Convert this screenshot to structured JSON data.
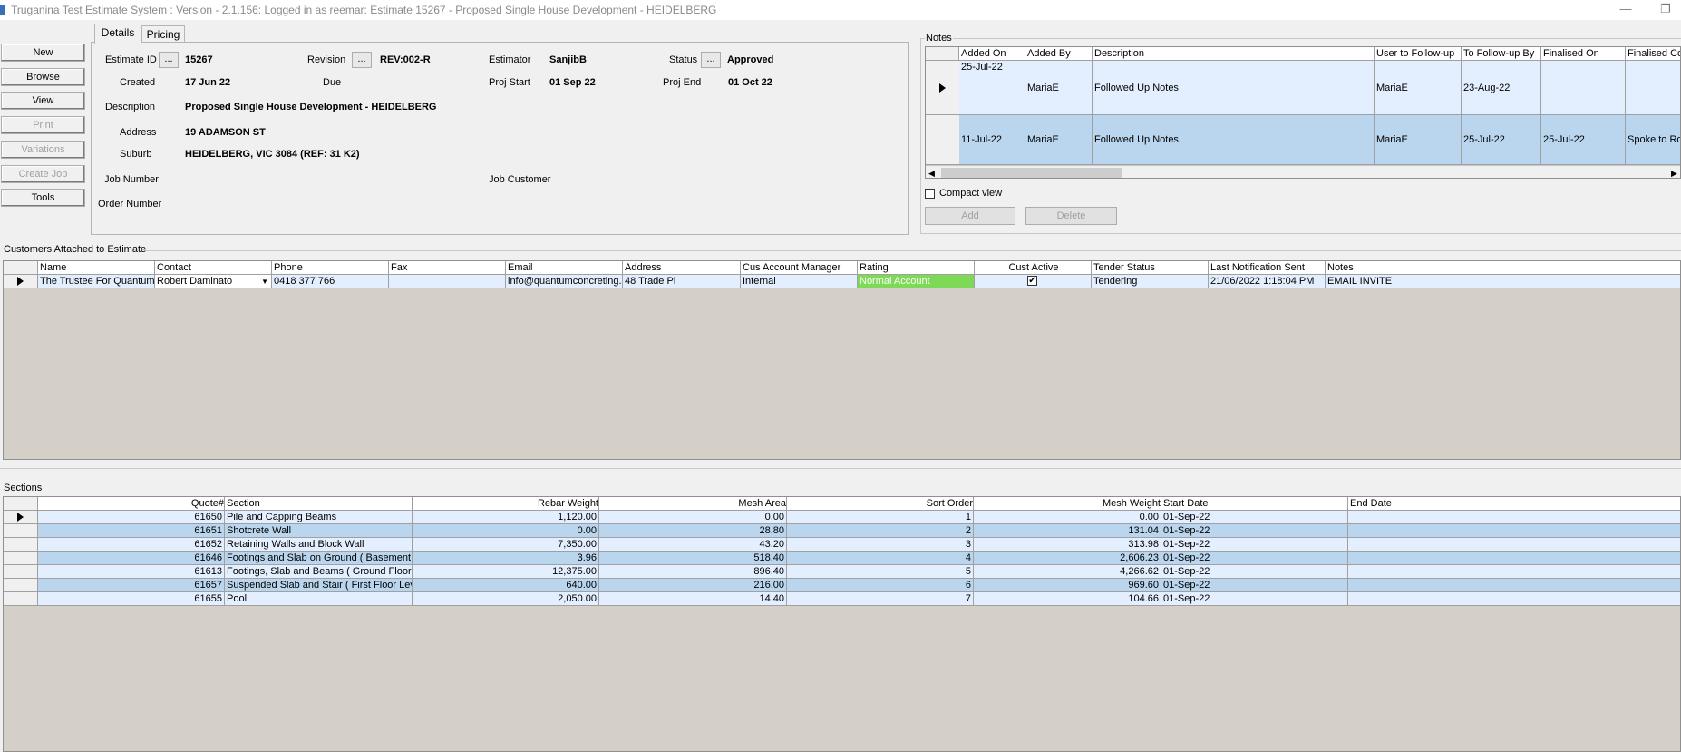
{
  "window": {
    "title": "Truganina Test Estimate System : Version - 2.1.156: Logged in as reemar: Estimate 15267 - Proposed Single House Development - HEIDELBERG"
  },
  "nav": {
    "new": "New",
    "browse": "Browse",
    "view": "View",
    "print": "Print",
    "variations": "Variations",
    "create_job": "Create Job",
    "tools": "Tools"
  },
  "tabs": {
    "details": "Details",
    "pricing": "Pricing"
  },
  "details": {
    "estimate_id_label": "Estimate ID",
    "estimate_id": "15267",
    "revision_label": "Revision",
    "revision": "REV:002-R",
    "estimator_label": "Estimator",
    "estimator": "SanjibB",
    "status_label": "Status",
    "status": "Approved",
    "created_label": "Created",
    "created": "17 Jun 22",
    "due_label": "Due",
    "proj_start_label": "Proj Start",
    "proj_start": "01 Sep 22",
    "proj_end_label": "Proj End",
    "proj_end": "01 Oct 22",
    "description_label": "Description",
    "description": "Proposed Single House Development - HEIDELBERG",
    "address_label": "Address",
    "address": "19 ADAMSON ST",
    "suburb_label": "Suburb",
    "suburb": "HEIDELBERG, VIC 3084 (REF: 31 K2)",
    "job_number_label": "Job Number",
    "job_customer_label": "Job Customer",
    "order_number_label": "Order Number",
    "dots": "..."
  },
  "notes": {
    "legend": "Notes",
    "columns": [
      "Added On",
      "Added By",
      "Description",
      "User to Follow-up",
      "To Follow-up By",
      "Finalised On",
      "Finalised Co"
    ],
    "rows": [
      [
        "25-Jul-22",
        "MariaE",
        "Followed Up Notes",
        "MariaE",
        "23-Aug-22",
        "",
        ""
      ],
      [
        "11-Jul-22",
        "MariaE",
        "Followed Up Notes",
        "MariaE",
        "25-Jul-22",
        "25-Jul-22",
        "Spoke to Ro"
      ]
    ],
    "compact_view": "Compact view",
    "add": "Add",
    "delete": "Delete"
  },
  "customers": {
    "legend": "Customers Attached to Estimate",
    "columns": [
      "Name",
      "Contact",
      "Phone",
      "Fax",
      "Email",
      "Address",
      "Cus Account Manager",
      "Rating",
      "Cust Active",
      "Tender Status",
      "Last Notification Sent",
      "Notes"
    ],
    "row": {
      "name": "The Trustee For Quantum",
      "contact": "Robert Daminato",
      "phone": "0418 377 766",
      "fax": "",
      "email": "info@quantumconcreting.c",
      "address": "48 Trade Pl",
      "manager": "Internal",
      "rating": "Normal Account",
      "cust_active": true,
      "tender_status": "Tendering",
      "last_notification": "21/06/2022 1:18:04 PM",
      "notes": "EMAIL INVITE"
    },
    "rating_color": "#7ed957"
  },
  "sections": {
    "legend": "Sections",
    "columns": [
      "Quote#",
      "Section",
      "Rebar Weight",
      "Mesh Area",
      "Sort Order",
      "Mesh Weight",
      "Start Date",
      "End Date"
    ],
    "rows": [
      [
        "61650",
        "Pile and Capping Beams",
        "1,120.00",
        "0.00",
        "1",
        "0.00",
        "01-Sep-22",
        ""
      ],
      [
        "61651",
        "Shotcrete Wall",
        "0.00",
        "28.80",
        "2",
        "131.04",
        "01-Sep-22",
        ""
      ],
      [
        "61652",
        "Retaining Walls and Block Wall",
        "7,350.00",
        "43.20",
        "3",
        "313.98",
        "01-Sep-22",
        ""
      ],
      [
        "61646",
        "Footings and Slab on Ground ( Basement L",
        "3.96",
        "518.40",
        "4",
        "2,606.23",
        "01-Sep-22",
        ""
      ],
      [
        "61613",
        "Footings, Slab and  Beams ( Ground Floor l",
        "12,375.00",
        "896.40",
        "5",
        "4,266.62",
        "01-Sep-22",
        ""
      ],
      [
        "61657",
        "Suspended Slab and Stair ( First Floor Leve",
        "640.00",
        "216.00",
        "6",
        "969.60",
        "01-Sep-22",
        ""
      ],
      [
        "61655",
        "Pool",
        "2,050.00",
        "14.40",
        "7",
        "104.66",
        "01-Sep-22",
        ""
      ]
    ]
  }
}
